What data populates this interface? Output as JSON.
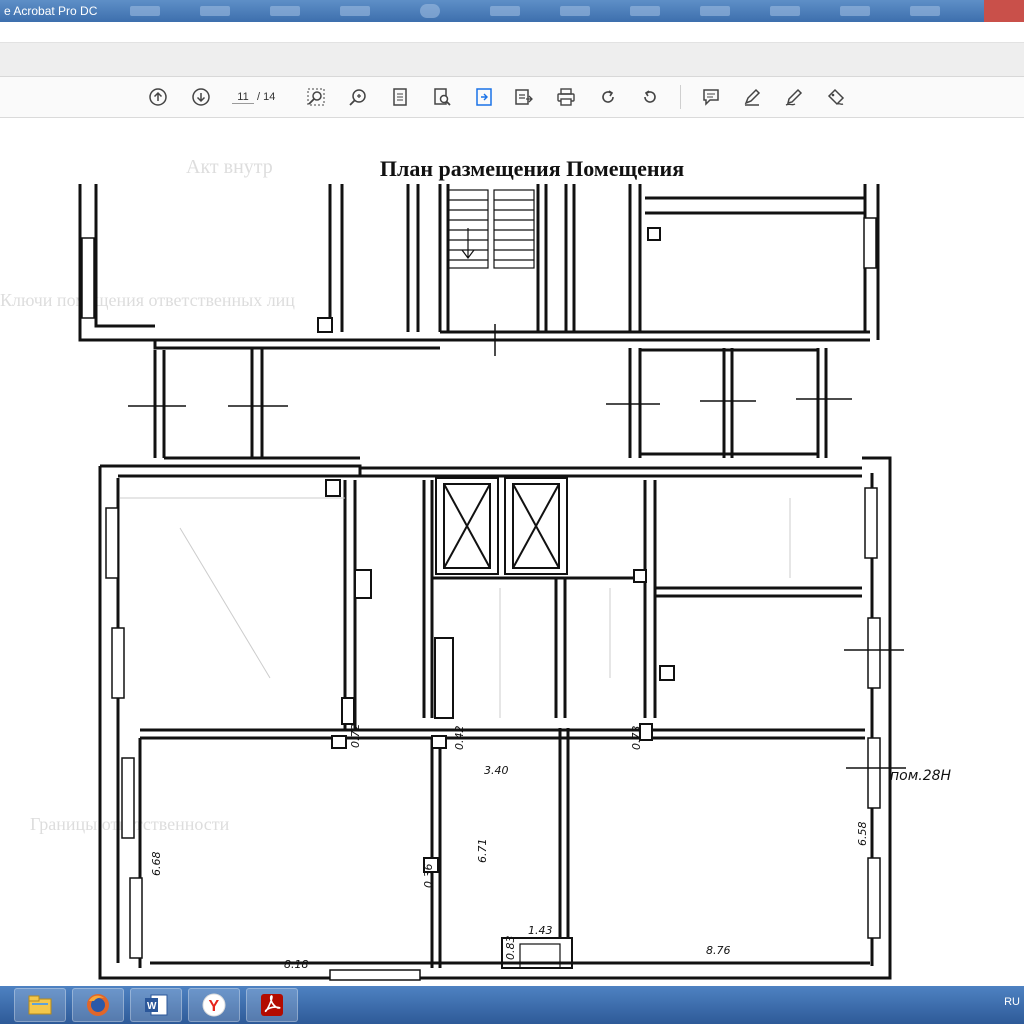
{
  "window": {
    "title": "e Acrobat Pro DC"
  },
  "toolbar": {
    "current_page": "11",
    "total_pages": "/ 14"
  },
  "document": {
    "plan_title": "План размещения Помещения",
    "room_label": "пом.28Н",
    "dimensions": [
      "3.40",
      "0.72",
      "0.42",
      "0.73",
      "6.68",
      "6.71",
      "6.58",
      "0.36",
      "0.83",
      "1.43",
      "8.18",
      "8.76"
    ]
  },
  "taskbar": {
    "tray_text": "RU",
    "apps": [
      "file-explorer-icon",
      "firefox-icon",
      "word-icon",
      "yandex-browser-icon",
      "acrobat-icon"
    ]
  },
  "colors": {
    "titlebar": "#3d6fad",
    "taskbar": "#2e5a98",
    "close": "#c9504a"
  }
}
